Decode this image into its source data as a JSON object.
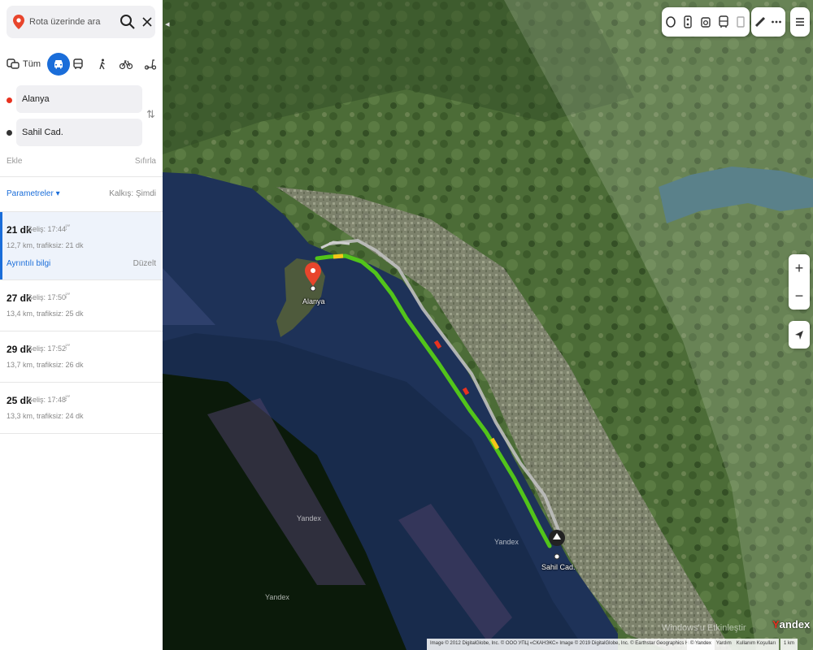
{
  "search": {
    "placeholder": "Rota üzerinde ara"
  },
  "modes": {
    "all_label": "Tüm"
  },
  "waypoints": {
    "from": "Alanya",
    "to": "Sahil Cad.",
    "add_label": "Ekle",
    "reset_label": "Sıfırla"
  },
  "params": {
    "label": "Parametreler ▾",
    "departure": "Kalkış: Şimdi"
  },
  "routes": [
    {
      "duration": "21 dk",
      "arrival": "Geliş: 17:44",
      "info": "12,7 km, trafiksiz: 21 dk",
      "details_label": "Ayrıntılı bilgi",
      "edit_label": "Düzelt"
    },
    {
      "duration": "27 dk",
      "arrival": "Geliş: 17:50",
      "info": "13,4 km, trafiksiz: 25 dk"
    },
    {
      "duration": "29 dk",
      "arrival": "Geliş: 17:52",
      "info": "13,7 km, trafiksiz: 26 dk"
    },
    {
      "duration": "25 dk",
      "arrival": "Geliş: 17:48",
      "info": "13,3 km, trafiksiz: 24 dk"
    }
  ],
  "map": {
    "start_label": "Alanya",
    "end_label": "Sahil Cad.",
    "watermarks": [
      "Yandex",
      "Yandex",
      "Yandex"
    ],
    "logo_first": "Y",
    "logo_rest": "andex",
    "windows_watermark": "Windows'u Etkinleştir",
    "copyright": "Image © 2012 DigitalGlobe, Inc. © ООО УПЦ «СКАНЭКС» Image © 2019 DigitalGlobe, Inc. © Earthstar Geographics   Hata bildirin",
    "footer_links": [
      "© Yandex",
      "Yardım",
      "Kullanım Koşulları"
    ],
    "scale": "1 km",
    "route_color": "#52c41a",
    "accent": "#1a6dd9",
    "start_marker_color": "#e8452c"
  }
}
